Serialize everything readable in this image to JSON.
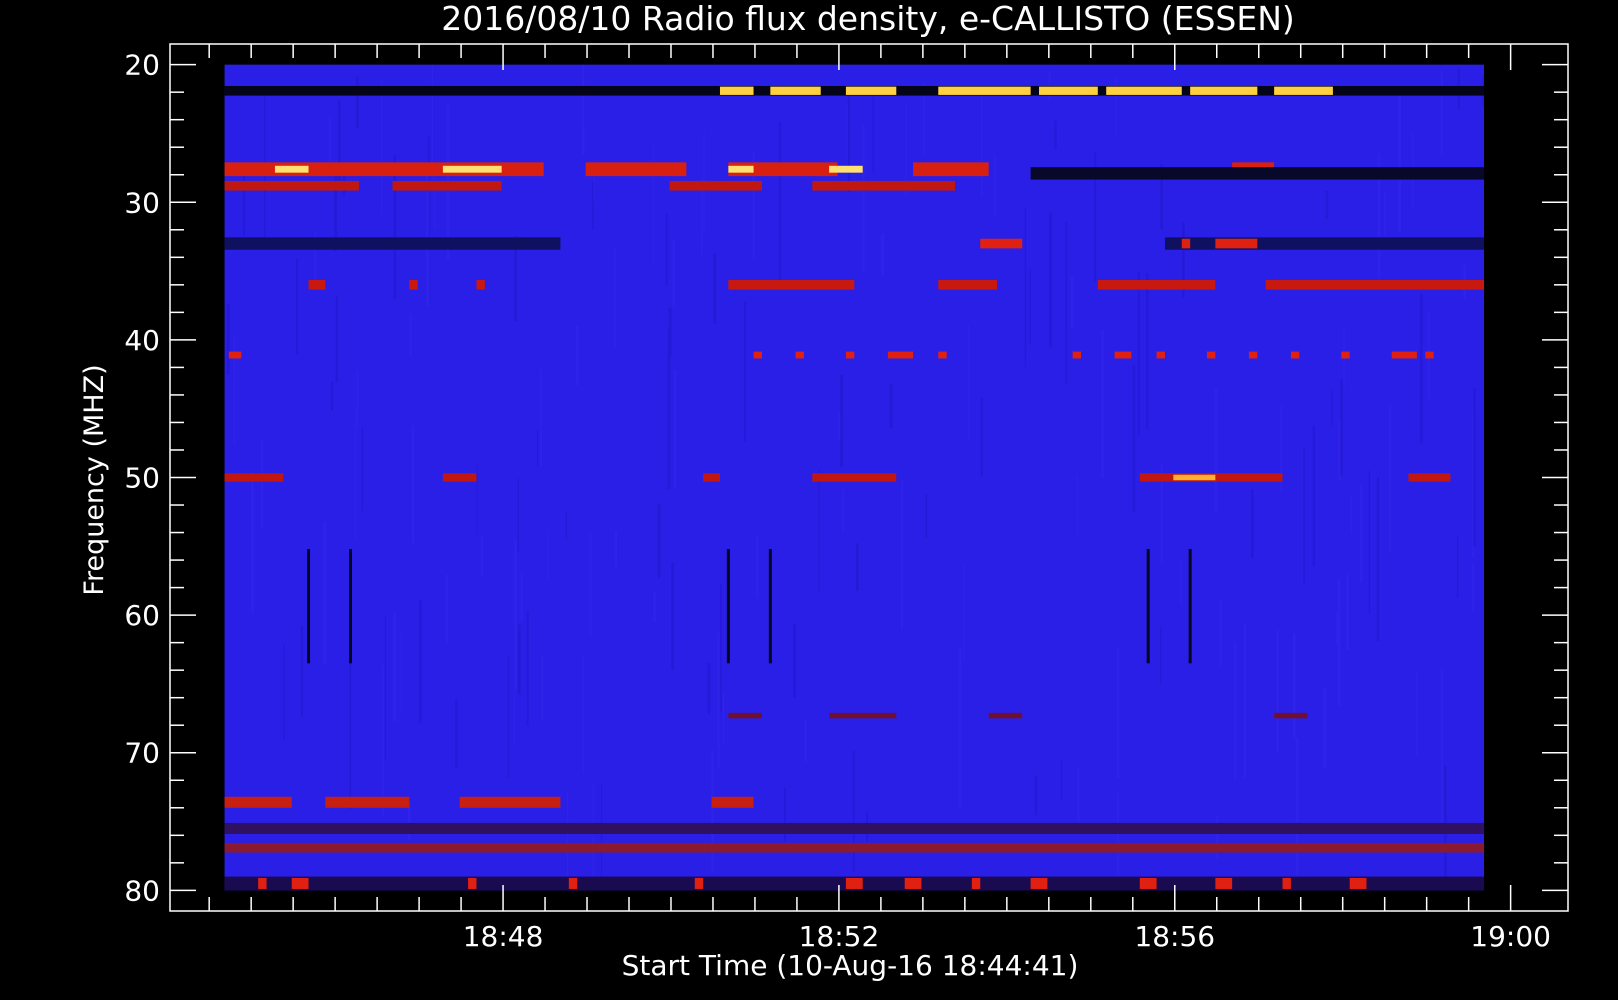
{
  "chart_data": {
    "type": "heatmap",
    "title": "2016/08/10  Radio flux density, e-CALLISTO (ESSEN)",
    "xlabel": "Start Time (10-Aug-16 18:44:41)",
    "ylabel": "Frequency (MHZ)",
    "x_ticks": [
      "18:48",
      "18:52",
      "18:56",
      "19:00"
    ],
    "x_tick_minutes": [
      3.3167,
      7.3167,
      11.3167,
      15.3167
    ],
    "x_range_minutes": [
      -0.65,
      16.0
    ],
    "data_range_minutes": [
      0,
      15.0
    ],
    "y_ticks": [
      "20",
      "30",
      "40",
      "50",
      "60",
      "70",
      "80"
    ],
    "y_tick_values": [
      20,
      30,
      40,
      50,
      60,
      70,
      80
    ],
    "ylim": [
      18.5,
      81.5
    ],
    "y_inverted": true,
    "background_color": "#2a1fe6",
    "colormap": [
      "#000000",
      "#1010c0",
      "#2a1fe6",
      "#b01010",
      "#ff2a00",
      "#ffe060",
      "#ffffff"
    ],
    "bands": [
      {
        "freq": 21.9,
        "thickness": 0.7,
        "color": "#05051a",
        "segments": [
          [
            0,
            15
          ]
        ]
      },
      {
        "freq": 21.9,
        "thickness": 0.6,
        "color": "#ffd040",
        "segments": [
          [
            5.9,
            6.3
          ],
          [
            6.5,
            7.1
          ],
          [
            7.4,
            8.0
          ],
          [
            8.5,
            9.6
          ],
          [
            9.7,
            10.4
          ],
          [
            10.5,
            11.4
          ],
          [
            11.5,
            12.3
          ],
          [
            12.5,
            13.2
          ]
        ]
      },
      {
        "freq": 27.6,
        "thickness": 1.0,
        "color": "#d82010",
        "segments": [
          [
            0,
            3.8
          ],
          [
            4.3,
            5.5
          ],
          [
            6.0,
            7.3
          ],
          [
            8.2,
            9.1
          ],
          [
            12.0,
            12.5
          ]
        ]
      },
      {
        "freq": 27.6,
        "thickness": 0.5,
        "color": "#ffe070",
        "segments": [
          [
            0.6,
            1.0
          ],
          [
            2.6,
            3.3
          ],
          [
            6.0,
            6.3
          ],
          [
            7.2,
            7.6
          ]
        ]
      },
      {
        "freq": 28.8,
        "thickness": 0.7,
        "color": "#c01810",
        "segments": [
          [
            0,
            1.6
          ],
          [
            2.0,
            3.3
          ],
          [
            5.3,
            6.4
          ],
          [
            7.0,
            8.7
          ]
        ]
      },
      {
        "freq": 27.9,
        "thickness": 0.9,
        "color": "#08082a",
        "segments": [
          [
            9.6,
            15.0
          ]
        ]
      },
      {
        "freq": 33.0,
        "thickness": 0.9,
        "color": "#101060",
        "segments": [
          [
            0,
            4.0
          ],
          [
            11.2,
            15.0
          ]
        ]
      },
      {
        "freq": 33.0,
        "thickness": 0.7,
        "color": "#e02010",
        "segments": [
          [
            9.0,
            9.5
          ],
          [
            11.4,
            11.5
          ],
          [
            11.8,
            12.3
          ]
        ]
      },
      {
        "freq": 36.0,
        "thickness": 0.7,
        "color": "#c81810",
        "segments": [
          [
            1.0,
            1.2
          ],
          [
            2.2,
            2.3
          ],
          [
            3.0,
            3.1
          ],
          [
            6.0,
            7.5
          ],
          [
            8.5,
            9.2
          ],
          [
            10.4,
            11.8
          ],
          [
            12.4,
            15.0
          ]
        ]
      },
      {
        "freq": 41.1,
        "thickness": 0.5,
        "color": "#e02010",
        "segments": [
          [
            0.05,
            0.2
          ],
          [
            6.3,
            6.4
          ],
          [
            6.8,
            6.9
          ],
          [
            7.4,
            7.5
          ],
          [
            7.9,
            8.2
          ],
          [
            8.5,
            8.6
          ],
          [
            10.1,
            10.2
          ],
          [
            10.6,
            10.8
          ],
          [
            11.1,
            11.2
          ],
          [
            11.7,
            11.8
          ],
          [
            12.2,
            12.3
          ],
          [
            12.7,
            12.8
          ],
          [
            13.3,
            13.4
          ],
          [
            13.9,
            14.2
          ],
          [
            14.3,
            14.4
          ]
        ]
      },
      {
        "freq": 50.0,
        "thickness": 0.6,
        "color": "#c01810",
        "segments": [
          [
            0,
            0.7
          ],
          [
            2.6,
            3.0
          ],
          [
            5.7,
            5.9
          ],
          [
            7.0,
            8.0
          ],
          [
            10.9,
            12.6
          ],
          [
            14.1,
            14.6
          ]
        ]
      },
      {
        "freq": 50.0,
        "thickness": 0.4,
        "color": "#ffb030",
        "segments": [
          [
            11.3,
            11.8
          ]
        ]
      },
      {
        "freq": 67.3,
        "thickness": 0.4,
        "color": "#701030",
        "segments": [
          [
            6.0,
            6.4
          ],
          [
            7.2,
            8.0
          ],
          [
            9.1,
            9.5
          ],
          [
            12.5,
            12.9
          ]
        ]
      },
      {
        "freq": 73.6,
        "thickness": 0.8,
        "color": "#c82010",
        "segments": [
          [
            0,
            0.8
          ],
          [
            1.2,
            2.2
          ],
          [
            2.8,
            4.0
          ],
          [
            5.8,
            6.3
          ]
        ]
      },
      {
        "freq": 75.5,
        "thickness": 0.8,
        "color": "#301060",
        "segments": [
          [
            0,
            15.0
          ]
        ]
      },
      {
        "freq": 76.9,
        "thickness": 0.7,
        "color": "#8a1a30",
        "segments": [
          [
            0,
            15.0
          ]
        ]
      },
      {
        "freq": 79.5,
        "thickness": 1.0,
        "color": "#1a0a50",
        "segments": [
          [
            0,
            15.0
          ]
        ]
      },
      {
        "freq": 79.5,
        "thickness": 0.8,
        "color": "#e02010",
        "segments": [
          [
            0.4,
            0.5
          ],
          [
            0.8,
            1.0
          ],
          [
            2.9,
            3.0
          ],
          [
            4.1,
            4.2
          ],
          [
            5.6,
            5.7
          ],
          [
            7.4,
            7.6
          ],
          [
            8.1,
            8.3
          ],
          [
            8.9,
            9.0
          ],
          [
            9.6,
            9.8
          ],
          [
            10.9,
            11.1
          ],
          [
            11.8,
            12.0
          ],
          [
            12.6,
            12.7
          ],
          [
            13.4,
            13.6
          ]
        ]
      }
    ],
    "spikes": [
      {
        "minute": 1.0,
        "freq_range": [
          55.2,
          63.5
        ]
      },
      {
        "minute": 1.5,
        "freq_range": [
          55.2,
          63.5
        ]
      },
      {
        "minute": 6.0,
        "freq_range": [
          55.2,
          63.5
        ]
      },
      {
        "minute": 6.5,
        "freq_range": [
          55.2,
          63.5
        ]
      },
      {
        "minute": 11.0,
        "freq_range": [
          55.2,
          63.5
        ]
      },
      {
        "minute": 11.5,
        "freq_range": [
          55.2,
          63.5
        ]
      }
    ]
  }
}
